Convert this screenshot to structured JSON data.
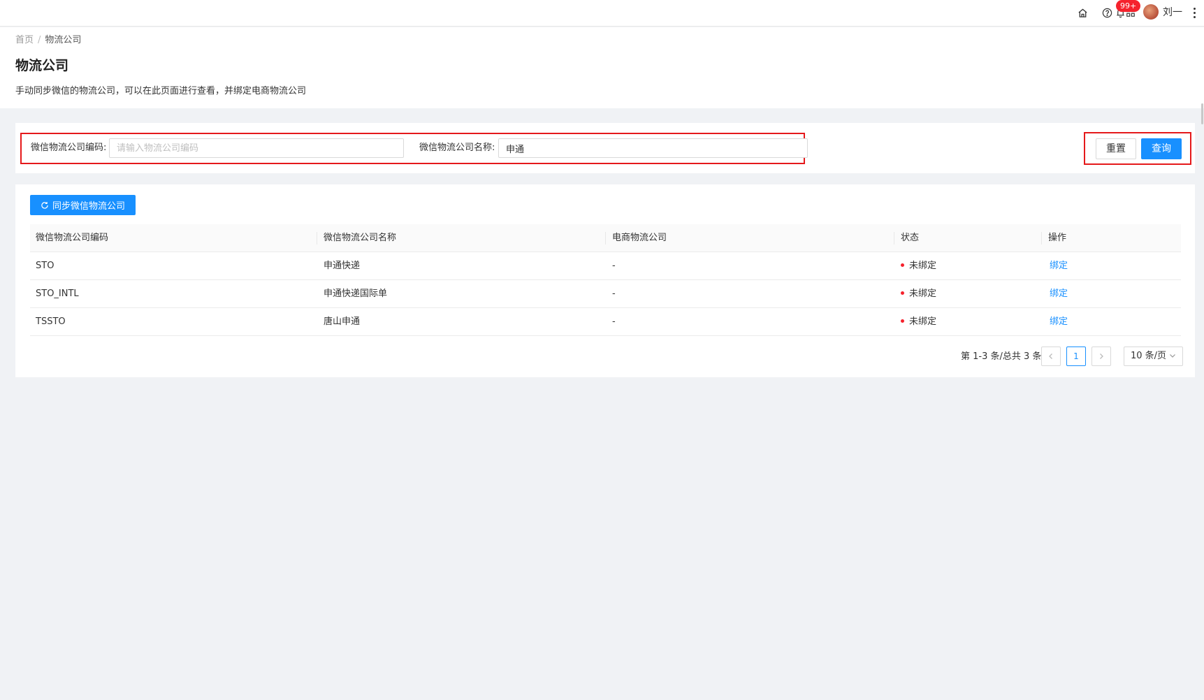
{
  "header": {
    "icons": [
      "home-icon",
      "help-icon",
      "apps-icon",
      "bell-icon"
    ],
    "notification_badge": "99+",
    "user_name": "刘一"
  },
  "breadcrumb": [
    "首页",
    "物流公司"
  ],
  "page": {
    "title": "物流公司",
    "description": "手动同步微信的物流公司，可以在此页面进行查看，并绑定电商物流公司"
  },
  "search": {
    "code_label": "微信物流公司编码:",
    "code_placeholder": "请输入物流公司编码",
    "code_value": "",
    "name_label": "微信物流公司名称:",
    "name_value": "申通",
    "reset_label": "重置",
    "query_label": "查询",
    "highlight_color": "#e5191b"
  },
  "toolbar": {
    "sync_label": "同步微信物流公司"
  },
  "table": {
    "columns": [
      "微信物流公司编码",
      "微信物流公司名称",
      "电商物流公司",
      "状态",
      "操作"
    ],
    "rows": [
      {
        "code": "STO",
        "name": "申通快递",
        "ecom": "-",
        "status": "未绑定",
        "action": "绑定"
      },
      {
        "code": "STO_INTL",
        "name": "申通快递国际单",
        "ecom": "-",
        "status": "未绑定",
        "action": "绑定"
      },
      {
        "code": "TSSTO",
        "name": "唐山申通",
        "ecom": "-",
        "status": "未绑定",
        "action": "绑定"
      }
    ]
  },
  "pagination": {
    "total_text": "第 1-3 条/总共 3 条",
    "current_page": "1",
    "page_size": "10 条/页"
  },
  "colors": {
    "primary": "#1890ff",
    "status_dot": "#f5222d",
    "background": "#f0f2f5"
  }
}
